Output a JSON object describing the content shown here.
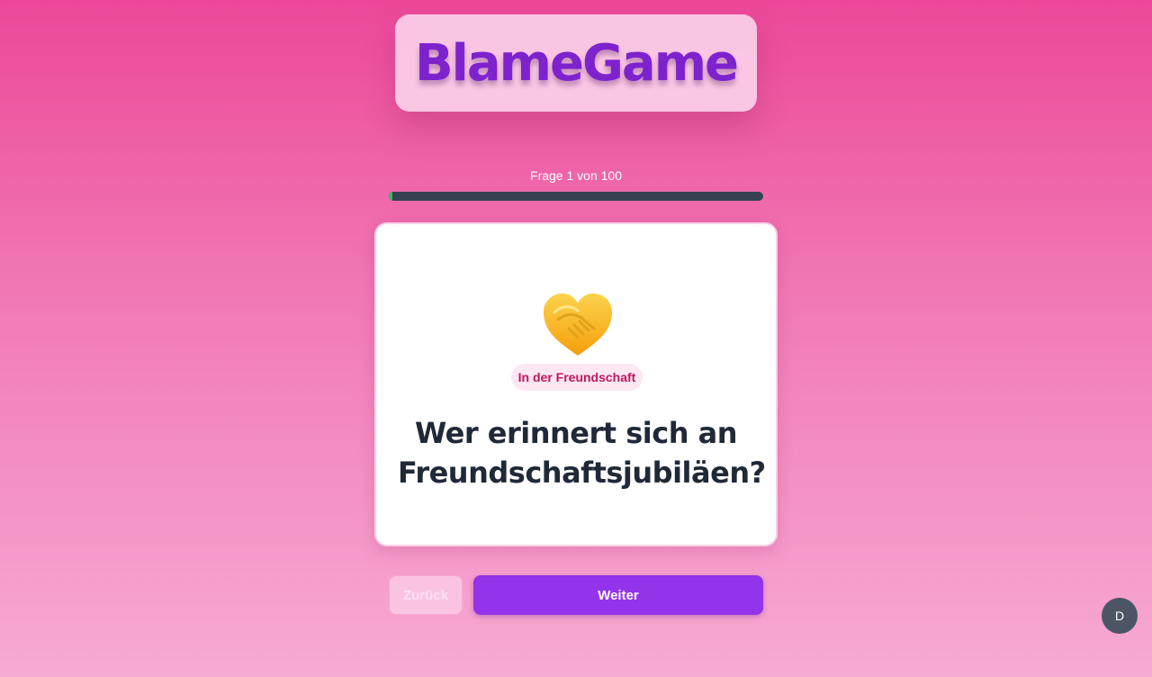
{
  "app": {
    "logo_text": "BlameGame"
  },
  "progress": {
    "label": "Frage 1 von 100",
    "current": 1,
    "total": 100,
    "fraction": 0.01
  },
  "question": {
    "icon": "handshake-heart-icon",
    "category": "In der Freundschaft",
    "line1": "Wer erinnert sich an",
    "line2": "Freundschaftsjubiläen?"
  },
  "nav": {
    "back_label": "Zurück",
    "next_label": "Weiter"
  },
  "user": {
    "avatar_initial": "D"
  },
  "colors": {
    "accent": "#9333ea",
    "logo": "#7e22ce",
    "progress_fill": "#22c55e",
    "badge_text": "#be185d"
  }
}
